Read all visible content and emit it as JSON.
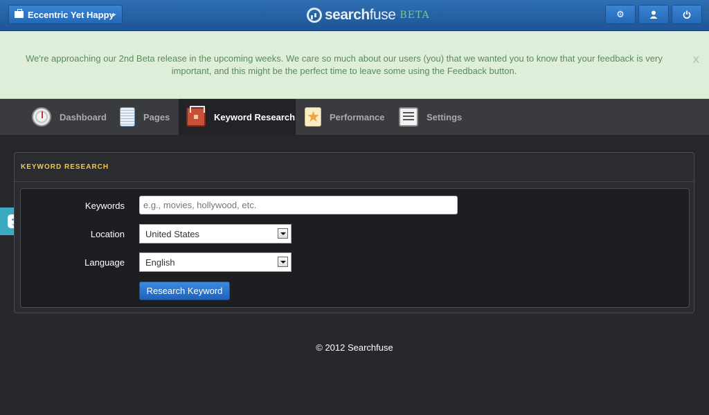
{
  "topbar": {
    "account_name": "Eccentric Yet Happy",
    "logo_bold": "search",
    "logo_light": "fuse",
    "logo_beta": "BETA",
    "icons": [
      "gear-icon",
      "user-icon",
      "power-icon"
    ]
  },
  "notice": {
    "message": "We're approaching our 2nd Beta release in the upcoming weeks. We care so much about our users (you) that we wanted you to know that your feedback is very important, and this might be the perfect time to leave some using the Feedback button.",
    "close": "X"
  },
  "tabs": [
    {
      "label": "Dashboard",
      "icon": "dashboard-icon",
      "active": false
    },
    {
      "label": "Pages",
      "icon": "pages-icon",
      "active": false
    },
    {
      "label": "Keyword Research",
      "icon": "toolbox-icon",
      "active": true
    },
    {
      "label": "Performance",
      "icon": "star-icon",
      "active": false
    },
    {
      "label": "Settings",
      "icon": "sliders-icon",
      "active": false
    }
  ],
  "panel": {
    "title": "KEYWORD RESEARCH",
    "keywords_label": "Keywords",
    "keywords_placeholder": "e.g., movies, hollywood, etc.",
    "keywords_value": "",
    "location_label": "Location",
    "location_value": "United States",
    "language_label": "Language",
    "language_value": "English",
    "submit_label": "Research Keyword"
  },
  "footer": {
    "copyright": "© 2012 Searchfuse"
  },
  "colors": {
    "topbar": "#2366ac",
    "notice_bg": "#dfeed9",
    "notice_text": "#5b8a5a",
    "panel_title": "#f1c84a",
    "feedback_tab": "#3aaac0"
  }
}
